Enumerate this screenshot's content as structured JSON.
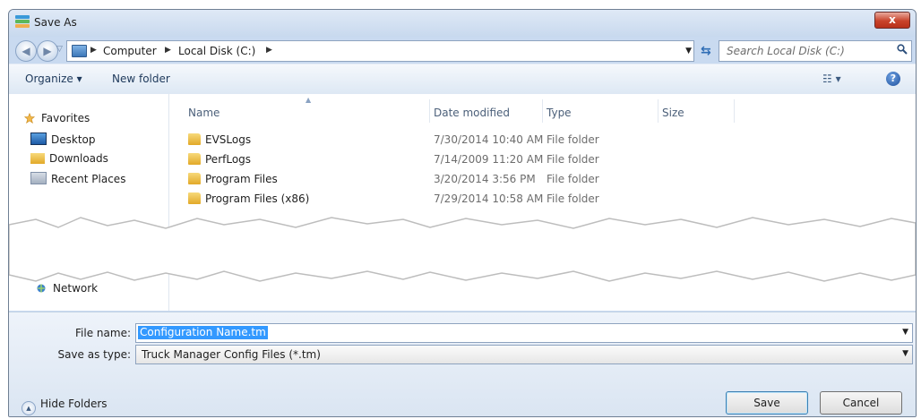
{
  "window": {
    "title": "Save As",
    "close_glyph": "x"
  },
  "nav": {
    "back_glyph": "◀",
    "forward_glyph": "▶",
    "breadcrumb": [
      "Computer",
      "Local Disk (C:)"
    ],
    "search_placeholder": "Search Local Disk (C:)"
  },
  "toolbar": {
    "organize_label": "Organize ▾",
    "new_folder_label": "New folder",
    "views_glyph": "☷ ▾",
    "help_glyph": "?"
  },
  "sidebar": {
    "items": [
      {
        "label": "Favorites",
        "icon": "star-icon"
      },
      {
        "label": "Desktop",
        "icon": "desktop-icon"
      },
      {
        "label": "Downloads",
        "icon": "downloads-icon"
      },
      {
        "label": "Recent Places",
        "icon": "recent-places-icon"
      },
      {
        "label": "Network",
        "icon": "network-icon"
      }
    ]
  },
  "file_list": {
    "columns": [
      "Name",
      "Date modified",
      "Type",
      "Size"
    ],
    "rows": [
      {
        "name": "EVSLogs",
        "date": "7/30/2014 10:40 AM",
        "type": "File folder"
      },
      {
        "name": "PerfLogs",
        "date": "7/14/2009 11:20 AM",
        "type": "File folder"
      },
      {
        "name": "Program Files",
        "date": "3/20/2014 3:56 PM",
        "type": "File folder"
      },
      {
        "name": "Program Files (x86)",
        "date": "7/29/2014 10:58 AM",
        "type": "File folder"
      }
    ]
  },
  "form": {
    "file_name_label": "File name:",
    "file_name_value": "Configuration Name.tm",
    "save_type_label": "Save as type:",
    "save_type_value": "Truck Manager Config Files (*.tm)"
  },
  "footer": {
    "hide_folders_label": "Hide Folders",
    "save_label": "Save",
    "cancel_label": "Cancel"
  },
  "colors": {
    "title_bar": "#c8d9ee",
    "close_button": "#c8432b",
    "selection": "#3399ff",
    "folder": "#e2a928"
  }
}
